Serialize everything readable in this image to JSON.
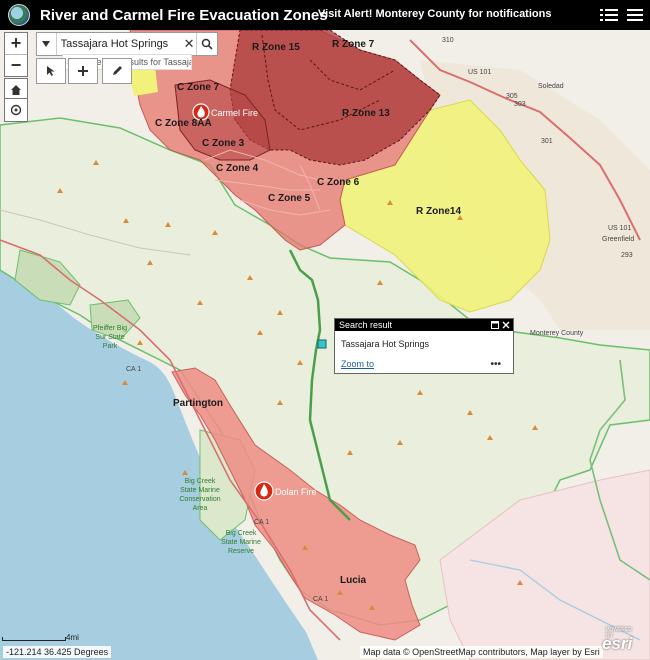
{
  "header": {
    "title": "River and Carmel Fire Evacuation Zones",
    "alert": "Visit Alert! Monterey County for notifications",
    "icons": [
      "app-logo",
      "legend-list-icon",
      "menu-icon"
    ]
  },
  "search": {
    "value": "Tassajara Hot Springs",
    "suggestion": "Show search results for Tassaja..."
  },
  "popup": {
    "title": "Search result",
    "content": "Tassajara Hot Springs",
    "zoom_link": "Zoom to",
    "more": "•••"
  },
  "zones": {
    "c7": "C Zone 7",
    "c8aa": "C Zone 8AA",
    "c3": "C Zone 3",
    "c4": "C Zone 4",
    "c5": "C Zone 5",
    "c6": "C Zone 6",
    "r15": "R Zone 15",
    "r7": "R Zone 7",
    "r13": "R Zone 13",
    "r14": "R Zone14"
  },
  "places": {
    "carmel_fire": "Carmel Fire",
    "dolan_fire": "Dolan Fire",
    "partington": "Partington",
    "lucia": "Lucia",
    "soledad": "Soledad",
    "greenfield": "Greenfield",
    "monterey_county": "Monterey County",
    "pfeiffer_line1": "Pfeiffer Big",
    "pfeiffer_line2": "Sur State",
    "pfeiffer_line3": "Park",
    "bigcreek1_line1": "Big Creek",
    "bigcreek1_line2": "State Marine",
    "bigcreek1_line3": "Conservation",
    "bigcreek1_line4": "Area",
    "bigcreek2_line1": "Big Creek",
    "bigcreek2_line2": "State Marine",
    "bigcreek2_line3": "Reserve",
    "us101_a": "US 101",
    "us101_b": "US 101",
    "ca1_a": "CA 1",
    "ca1_b": "CA 1",
    "ca1_c": "CA 1",
    "r310": "310",
    "r305": "305",
    "r303": "303",
    "r301": "301",
    "r293": "293"
  },
  "footer": {
    "coordinates": "-121.214 36.425 Degrees",
    "attribution": "Map data © OpenStreetMap contributors, Map layer by Esri",
    "scale_label": "4mi",
    "esri": "esri",
    "esri_powered": "POWERED BY"
  },
  "colors": {
    "header": "#000000",
    "ocean": "#a7cde0",
    "land": "#f2efe9",
    "park": "#c9ddb8",
    "zone_c": "#e4766b",
    "zone_r_dark": "#a93939",
    "zone_r14": "#f1f27a",
    "dolan_zone": "#ef8c85",
    "fire_icon": "#d22a16"
  }
}
